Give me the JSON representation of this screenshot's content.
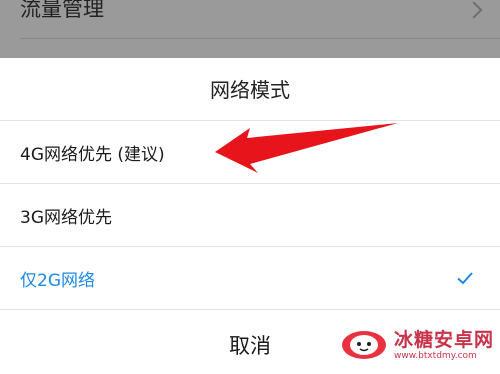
{
  "background_list": {
    "item_label": "流量管理"
  },
  "sheet": {
    "title": "网络模式",
    "options": [
      {
        "label": "4G网络优先 (建议)",
        "selected": false
      },
      {
        "label": "3G网络优先",
        "selected": false
      },
      {
        "label": "仅2G网络",
        "selected": true
      }
    ],
    "cancel_label": "取消"
  },
  "annotation": {
    "arrow_color": "#e8141c"
  },
  "watermark": {
    "name": "冰糖安卓网",
    "url": "www.btxtdmy.com"
  },
  "colors": {
    "selected": "#1e88e5",
    "dim_background": "#9a9a9a"
  }
}
